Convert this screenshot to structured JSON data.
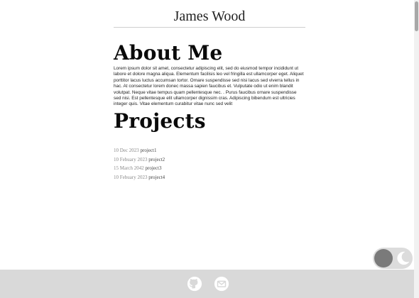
{
  "header": {
    "site_name": "James Wood"
  },
  "about": {
    "heading": "About Me",
    "body": "Lorem ipsum dolor sit amet, consectetur adipiscing elit, sed do eiusmod tempor incididunt ut labore et dolore magna aliqua. Elementum facilisis leo vel fringilla est ullamcorper eget. Aliquet porttitor lacus luctus accumsan tortor. Ornare suspendisse sed nisi lacus sed viverra tellus in hac. At consectetur lorem donec massa sapien faucibus et. Vulputate odio ut enim blandit volutpat. Neque vitae tempus quam pellentesque nec. . Purus faucibus ornare suspendisse sed nisi. Est pellentesque elit ullamcorper dignissim cras. Adipiscing bibendum est ultricies integer quis. Vitae elementum curabitur vitae nunc sed velit"
  },
  "projects": {
    "heading": "Projects",
    "items": [
      {
        "date": "10 Dec 2023",
        "title": "project1"
      },
      {
        "date": "10 Febuary 2023",
        "title": "project2"
      },
      {
        "date": "15 March 2042",
        "title": "project3"
      },
      {
        "date": "10 Febuary 2023",
        "title": "project4"
      }
    ]
  },
  "theme_toggle": {
    "state": "light",
    "icon": "moon-icon"
  },
  "footer": {
    "icons": [
      "github-icon",
      "mail-icon"
    ]
  },
  "colors": {
    "footer_bg": "#d9d9d9",
    "toggle_knob": "#7a7a7a",
    "date_gray": "#8a8a8a"
  }
}
